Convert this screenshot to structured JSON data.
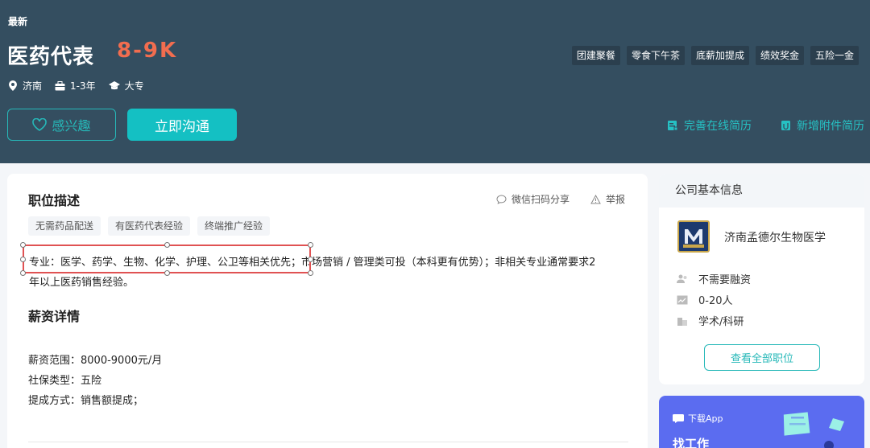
{
  "header": {
    "tag": "最新",
    "title": "医药代表",
    "salary": "8-9K",
    "location": "济南",
    "experience": "1-3年",
    "education": "大专",
    "benefits": [
      "团建聚餐",
      "零食下午茶",
      "底薪加提成",
      "绩效奖金",
      "五险一金"
    ],
    "interest_label": "感兴趣",
    "chat_label": "立即沟通",
    "improve_resume": "完善在线简历",
    "add_attachment": "新增附件简历"
  },
  "job": {
    "section_title": "职位描述",
    "share_label": "微信扫码分享",
    "report_label": "举报",
    "tags": [
      "无需药品配送",
      "有医药代表经验",
      "终端推广经验"
    ],
    "description_line1": "专业：医学、药学、生物、化学、护理、公卫等相关优先；市场营销 / 管理类可投（本科更有优势）；非相关专业通常要求2",
    "description_line2": "年以上医药销售经验。",
    "salary_title": "薪资详情",
    "salary_range": "薪资范围：8000-9000元/月",
    "insurance": "社保类型：五险",
    "commission": "提成方式：销售额提成；"
  },
  "company": {
    "section_title": "公司基本信息",
    "name": "济南孟德尔生物医学",
    "financing": "不需要融资",
    "size": "0-20人",
    "industry": "学术/科研",
    "all_jobs_label": "查看全部职位"
  },
  "app_banner": {
    "label": "下载App",
    "title": "找工作"
  },
  "colors": {
    "header_bg": "#344e60",
    "salary": "#f26d4f",
    "accent": "#14c0c3",
    "selection_border": "#e05253"
  }
}
